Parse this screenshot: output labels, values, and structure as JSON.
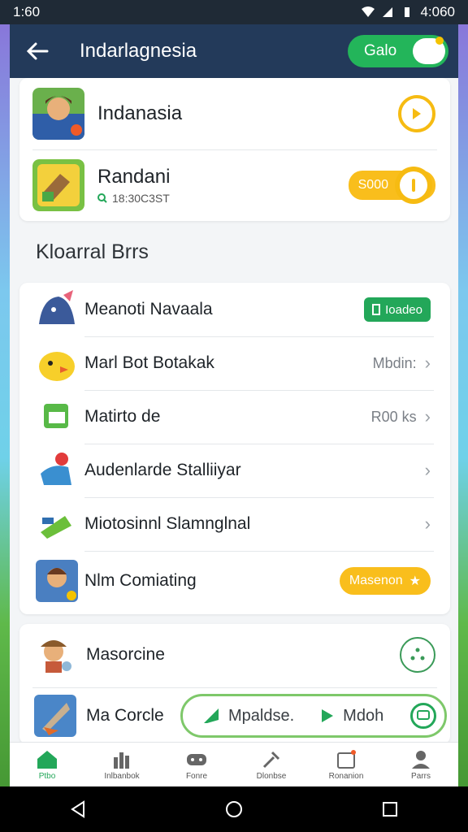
{
  "status_bar": {
    "time": "1:60",
    "battery": "4:060"
  },
  "app_bar": {
    "title": "Indarlagnesia",
    "toggle_label": "Galo"
  },
  "profiles": [
    {
      "name": "Indanasia"
    },
    {
      "name": "Randani",
      "subtitle": "18:30C3ST",
      "badge": "S000"
    }
  ],
  "section_title": "Kloarral  Brrs",
  "list_items": [
    {
      "label": "Meanoti Navaala",
      "badge": "Ioadeo"
    },
    {
      "label": "Marl Bot Botakak",
      "meta": "Mbdin:"
    },
    {
      "label": "Matirto de",
      "meta": "R00 ks"
    },
    {
      "label": "Audenlarde Stalliiyar"
    },
    {
      "label": "Miotosinnl Slamnglnal"
    },
    {
      "label": "Nlm Comiating",
      "badge": "Masenon"
    }
  ],
  "bottom_items": [
    {
      "label": "Masorcine"
    },
    {
      "label": "Ma Corcle"
    }
  ],
  "floating_bar": {
    "item1": "Mpaldse.",
    "item2": "Mdoh"
  },
  "bottom_nav": [
    {
      "label": "Ptbo",
      "icon": "home-icon"
    },
    {
      "label": "Inlbanbok",
      "icon": "stats-icon"
    },
    {
      "label": "Fonre",
      "icon": "games-icon"
    },
    {
      "label": "Dlonbse",
      "icon": "tools-icon"
    },
    {
      "label": "Ronanion",
      "icon": "calendar-icon"
    },
    {
      "label": "Parrs",
      "icon": "profile-icon"
    }
  ],
  "colors": {
    "accent_green": "#23a759",
    "accent_yellow": "#f9be1c",
    "appbar_blue": "#233a5a"
  }
}
